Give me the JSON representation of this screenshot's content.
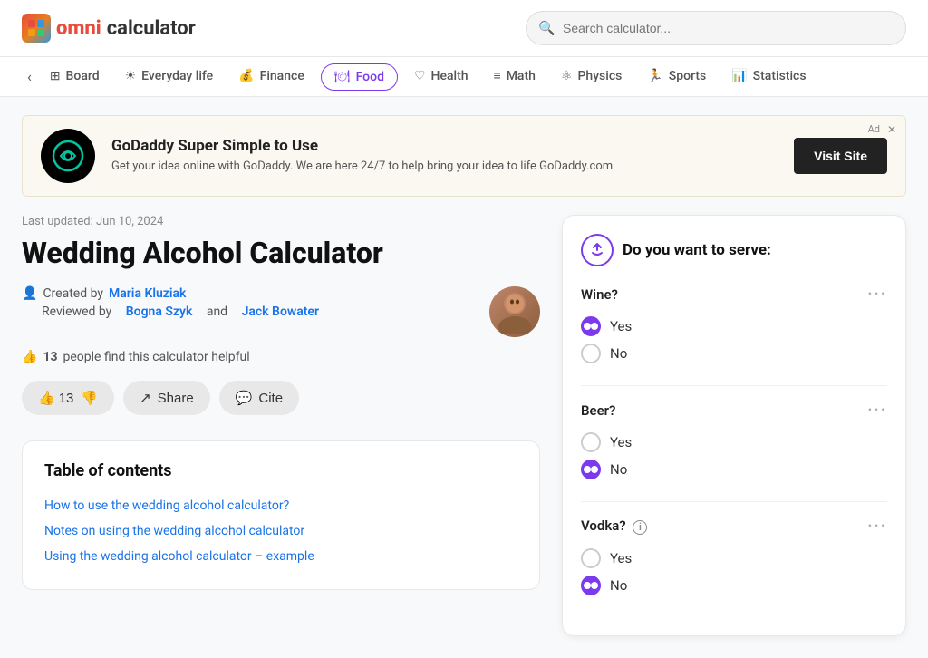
{
  "logo": {
    "omni": "omni",
    "calculator": "calculator"
  },
  "search": {
    "placeholder": "Search calculator..."
  },
  "nav": {
    "tabs": [
      {
        "id": "board",
        "label": "Board",
        "icon": "⊞",
        "active": false
      },
      {
        "id": "everyday",
        "label": "Everyday life",
        "icon": "☀",
        "active": false
      },
      {
        "id": "finance",
        "label": "Finance",
        "icon": "$",
        "active": false
      },
      {
        "id": "food",
        "label": "Food",
        "icon": "🍽",
        "active": true
      },
      {
        "id": "health",
        "label": "Health",
        "icon": "♡",
        "active": false
      },
      {
        "id": "math",
        "label": "Math",
        "icon": "≡",
        "active": false
      },
      {
        "id": "physics",
        "label": "Physics",
        "icon": "⚛",
        "active": false
      },
      {
        "id": "sports",
        "label": "Sports",
        "icon": "🏃",
        "active": false
      },
      {
        "id": "statistics",
        "label": "Statistics",
        "icon": "📊",
        "active": false
      }
    ]
  },
  "ad": {
    "title": "GoDaddy Super Simple to Use",
    "description": "Get your idea online with GoDaddy. We are here 24/7 to help bring your idea to life GoDaddy.com",
    "button_label": "Visit Site",
    "close_label": "✕",
    "ad_label": "Ad"
  },
  "article": {
    "last_updated": "Last updated: Jun 10, 2024",
    "title": "Wedding Alcohol Calculator",
    "created_by_label": "Created by",
    "created_by_name": "Maria Kluziak",
    "reviewed_by_label": "Reviewed by",
    "reviewer1": "Bogna Szyk",
    "reviewer_and": "and",
    "reviewer2": "Jack Bowater",
    "helpful_count": "13",
    "helpful_text": "people find this calculator helpful",
    "like_count": "13",
    "actions": {
      "like": "13",
      "share": "Share",
      "cite": "Cite"
    },
    "toc": {
      "title": "Table of contents",
      "links": [
        "How to use the wedding alcohol calculator?",
        "Notes on using the wedding alcohol calculator",
        "Using the wedding alcohol calculator – example"
      ]
    }
  },
  "calculator": {
    "header": "Do you want to serve:",
    "questions": [
      {
        "label": "Wine?",
        "options": [
          {
            "label": "Yes",
            "selected": true
          },
          {
            "label": "No",
            "selected": false
          }
        ]
      },
      {
        "label": "Beer?",
        "options": [
          {
            "label": "Yes",
            "selected": false
          },
          {
            "label": "No",
            "selected": true
          }
        ]
      },
      {
        "label": "Vodka?",
        "has_info": true,
        "options": [
          {
            "label": "Yes",
            "selected": false
          },
          {
            "label": "No",
            "selected": true
          }
        ]
      }
    ]
  }
}
